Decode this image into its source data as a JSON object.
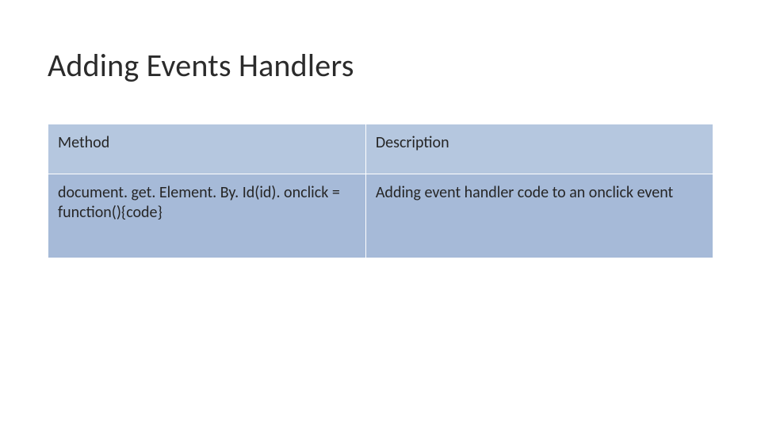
{
  "title": "Adding Events Handlers",
  "table": {
    "headers": {
      "method": "Method",
      "description": "Description"
    },
    "rows": [
      {
        "method": "document. get. Element. By. Id(id). onclick = function(){code}",
        "description": "Adding event handler code to an onclick event"
      }
    ]
  }
}
